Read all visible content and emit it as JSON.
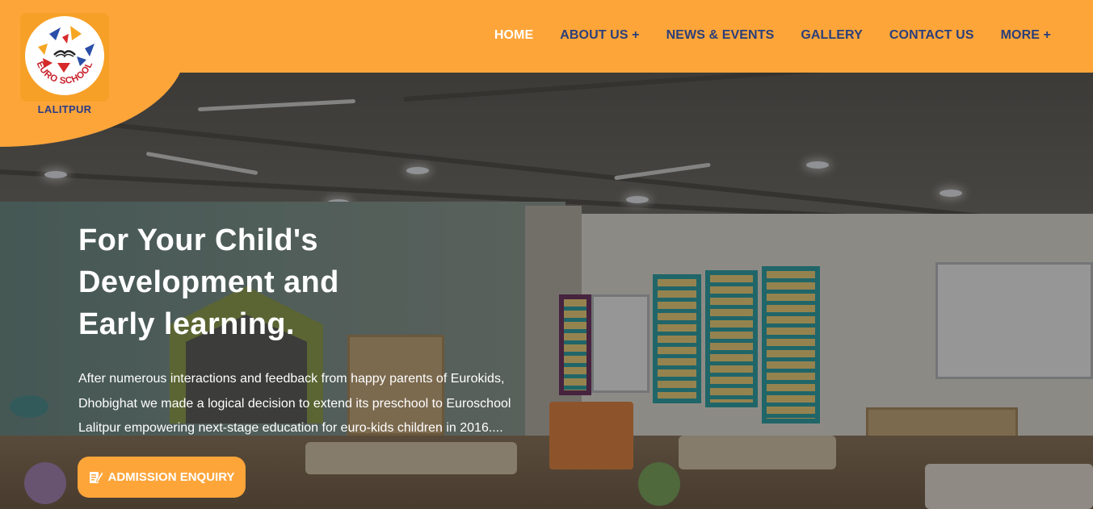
{
  "brand": {
    "logo_text": "EURO SCHOOL",
    "location": "LALITPUR",
    "accent_color": "#fea53a",
    "nav_text_color": "#2a3f7a"
  },
  "nav": {
    "items": [
      {
        "label": "HOME",
        "active": true
      },
      {
        "label": "ABOUT US +"
      },
      {
        "label": "NEWS & EVENTS"
      },
      {
        "label": "GALLERY"
      },
      {
        "label": "CONTACT US"
      },
      {
        "label": "MORE +"
      }
    ]
  },
  "hero": {
    "title_lines": [
      "For Your Child's",
      "Development and",
      "Early learning."
    ],
    "description_lines": [
      "After numerous interactions and feedback from happy parents of Eurokids,",
      "Dhobighat we made a logical decision to extend its preschool to Euroschool",
      "Lalitpur empowering next-stage education for euro-kids children in 2016...."
    ],
    "cta_label": "ADMISSION ENQUIRY",
    "cta_icon": "edit-document-icon",
    "background": "classroom-photo"
  }
}
